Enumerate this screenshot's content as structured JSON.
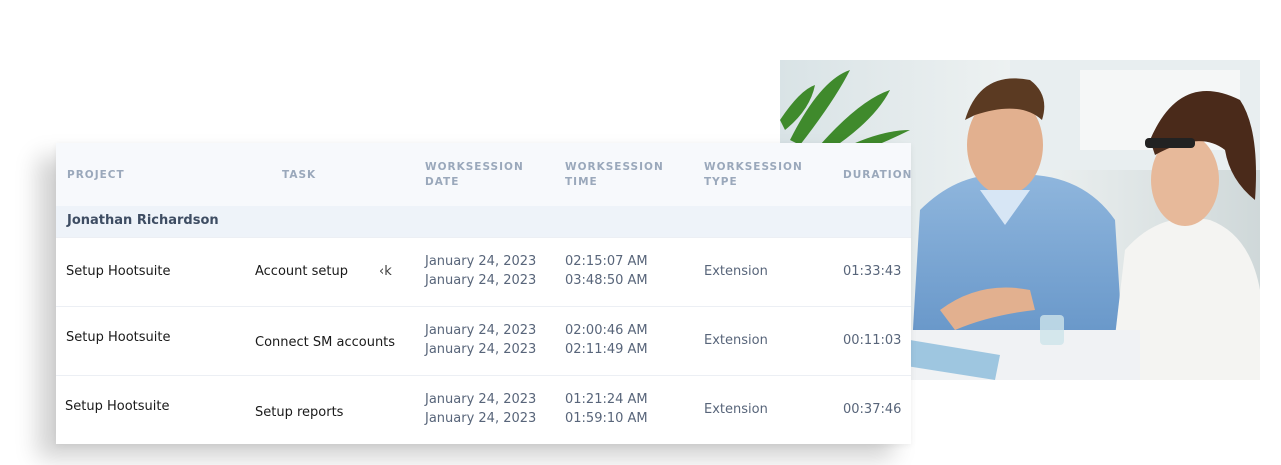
{
  "table": {
    "headers": {
      "project": "PROJECT",
      "task": "TASK",
      "worksession_date": [
        "WORKSESSION",
        "DATE"
      ],
      "worksession_time": [
        "WORKSESSION",
        "TIME"
      ],
      "worksession_type": [
        "WORKSESSION",
        "TYPE"
      ],
      "duration": "DURATION"
    },
    "group": "Jonathan Richardson",
    "rows": [
      {
        "project": "Setup Hootsuite",
        "task": "Account setup",
        "task_fragment": "‹k",
        "date_start": "January 24, 2023",
        "date_end": "January 24, 2023",
        "time_start": "02:15:07 AM",
        "time_end": "03:48:50 AM",
        "type": "Extension",
        "duration": "01:33:43"
      },
      {
        "project": "Setup Hootsuite",
        "task": "Connect SM accounts",
        "date_start": "January 24, 2023",
        "date_end": "January 24, 2023",
        "time_start": "02:00:46 AM",
        "time_end": "02:11:49 AM",
        "type": "Extension",
        "duration": "00:11:03"
      },
      {
        "project": "Setup Hootsuite",
        "task": "Setup reports",
        "date_start": "January 24, 2023",
        "date_end": "January 24, 2023",
        "time_start": "01:21:24 AM",
        "time_end": "01:59:10 AM",
        "type": "Extension",
        "duration": "00:37:46"
      }
    ]
  },
  "colors": {
    "header_bg": "#f7f9fc",
    "header_text": "#9aa8bb",
    "group_bg": "#eef3f9",
    "muted_text": "#58657a"
  }
}
